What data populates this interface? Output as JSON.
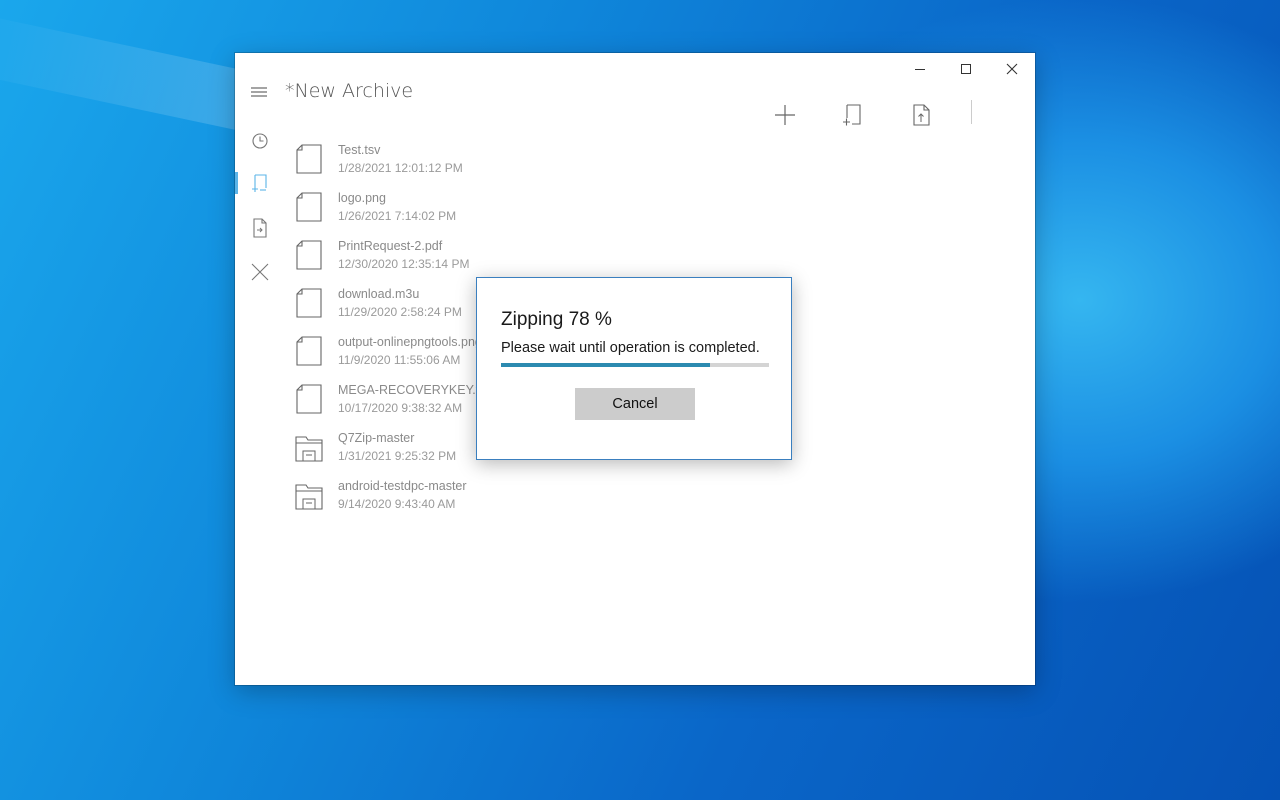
{
  "window": {
    "title": "*New Archive",
    "caption_buttons": {
      "minimize": "minimize-icon",
      "maximize": "maximize-icon",
      "close": "close-icon"
    }
  },
  "sidebar": {
    "items": [
      {
        "icon": "menu-icon"
      },
      {
        "icon": "recent-icon"
      },
      {
        "icon": "new-archive-icon",
        "active": true
      },
      {
        "icon": "extract-icon"
      },
      {
        "icon": "close-archive-icon"
      }
    ]
  },
  "toolbar": {
    "items": [
      {
        "icon": "add-icon"
      },
      {
        "icon": "add-to-archive-icon"
      },
      {
        "icon": "extract-file-icon"
      }
    ]
  },
  "files": [
    {
      "name": "Test.tsv",
      "date": "1/28/2021 12:01:12 PM",
      "type": "file"
    },
    {
      "name": "logo.png",
      "date": "1/26/2021 7:14:02 PM",
      "type": "file"
    },
    {
      "name": "PrintRequest-2.pdf",
      "date": "12/30/2020 12:35:14 PM",
      "type": "file"
    },
    {
      "name": "download.m3u",
      "date": "11/29/2020 2:58:24 PM",
      "type": "file"
    },
    {
      "name": "output-onlinepngtools.png",
      "date": "11/9/2020 11:55:06 AM",
      "type": "file"
    },
    {
      "name": "MEGA-RECOVERYKEY.txt",
      "date": "10/17/2020 9:38:32 AM",
      "type": "file"
    },
    {
      "name": "Q7Zip-master",
      "date": "1/31/2021 9:25:32 PM",
      "type": "folder"
    },
    {
      "name": "android-testdpc-master",
      "date": "9/14/2020 9:43:40 AM",
      "type": "folder"
    }
  ],
  "dialog": {
    "title": "Zipping 78 %",
    "message": "Please wait until operation is completed.",
    "progress": 0.78,
    "cancel_label": "Cancel"
  },
  "colors": {
    "accent": "#2c8ab0",
    "dialog_border": "#3a7fbf",
    "button_bg": "#cccccc"
  }
}
